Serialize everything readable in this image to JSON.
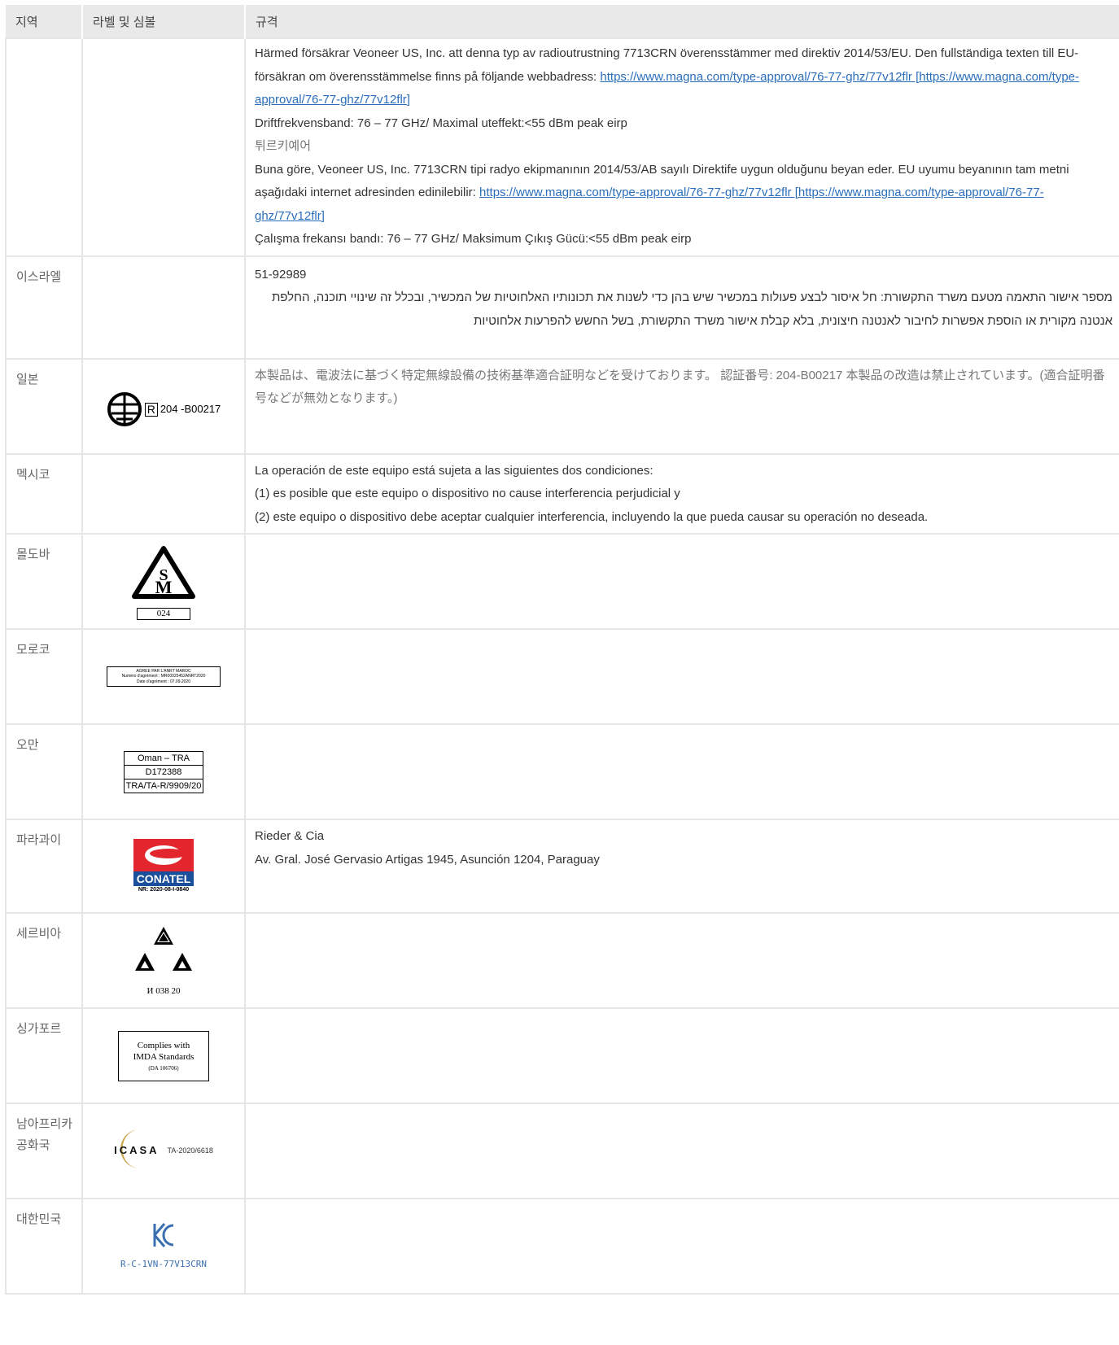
{
  "headers": [
    "지역",
    "라벨 및 심볼",
    "규격"
  ],
  "sweden": {
    "p1_a": "Härmed försäkrar Veoneer US, Inc. att denna typ av radioutrustning 7713CRN överensstämmer med direktiv 2014/53/EU. Den fullständiga texten till EU-försäkran om överensstämmelse finns på följande webbadress: ",
    "link": "https://www.magna.com/type-approval/76-77-ghz/77v12flr [https://www.magna.com/type-approval/76-77-ghz/77v12flr]",
    "freq": "Driftfrekvensband: 76 – 77 GHz/ Maximal uteffekt:<55 dBm peak eirp"
  },
  "turkey": {
    "title": "튀르키예어",
    "p1": "Buna göre, Veoneer US, Inc. 7713CRN tipi radyo ekipmanının 2014/53/AB sayılı Direktife uygun olduğunu beyan eder. EU uyumu beyanının tam metni aşağıdaki internet adresinden edinilebilir: ",
    "link": "https://www.magna.com/type-approval/76-77-ghz/77v12flr [https://www.magna.com/type-approval/76-77-ghz/77v12flr]",
    "freq": "Çalışma frekansı bandı: 76 – 77 GHz/ Maksimum Çıkış Gücü:<55 dBm peak eirp"
  },
  "rows": {
    "israel": {
      "region": "이스라엘",
      "code": "51-92989",
      "text": "מספר אישור התאמה מטעם משרד התקשורת: חל איסור לבצע פעולות במכשיר שיש בהן כדי לשנות את תכונותיו האלחוטיות של המכשיר, ובכלל זה שינויי תוכנה, החלפת אנטנה מקורית או הוספת אפשרות לחיבור לאנטנה חיצונית, בלא קבלת אישור משרד התקשורת, בשל החשש להפרעות אלחוטיות"
    },
    "japan": {
      "region": "일본",
      "label_r": "R",
      "label_code": "204 -B00217",
      "text": "本製品は、電波法に基づく特定無線設備の技術基準適合証明などを受けております。 認証番号: 204-B00217 本製品の改造は禁止されています。(適合証明番号などが無効となります。)"
    },
    "mexico": {
      "region": "멕시코",
      "l1": "La operación de este equipo está sujeta a las siguientes dos condiciones:",
      "l2": "(1) es posible que este equipo o dispositivo no cause interferencia perjudicial y",
      "l3": "(2) este equipo o dispositivo debe aceptar cualquier interferencia, incluyendo la que pueda causar su operación no deseada."
    },
    "moldova": {
      "region": "몰도바",
      "label_code": "024"
    },
    "morocco": {
      "region": "모로코",
      "t1": "AGREE PAR L'ANRT MAROC",
      "t2": "Numéro d'agrément : MR00025452ANRT2020",
      "t3": "Date d'agrément : 07.09.2020"
    },
    "oman": {
      "region": "오만",
      "t1": "Oman – TRA",
      "t2": "D172388",
      "t3": "TRA/TA-R/9909/20"
    },
    "paraguay": {
      "region": "파라과이",
      "brand": "CONATEL",
      "nr": "NR: 2020-08-I-0840",
      "name": "Rieder & Cia",
      "addr": "Av. Gral. José Gervasio Artigas 1945, Asunción 1204, Paraguay"
    },
    "serbia": {
      "region": "세르비아",
      "code": "И 038 20"
    },
    "singapore": {
      "region": "싱가포르",
      "t1": "Complies with",
      "t2": "IMDA Standards",
      "t3": "(DA 106706)"
    },
    "southafrica": {
      "region": "남아프리카 공화국",
      "brand": "ICASA",
      "code": "TA-2020/6618"
    },
    "korea": {
      "region": "대한민국",
      "code": "R-C-1VN-77V13CRN"
    }
  },
  "colors": {
    "link": "#2a6ebb",
    "conatel_red": "#e3262d",
    "conatel_blue": "#1a4f9c",
    "kc_blue": "#3a6fb0"
  }
}
